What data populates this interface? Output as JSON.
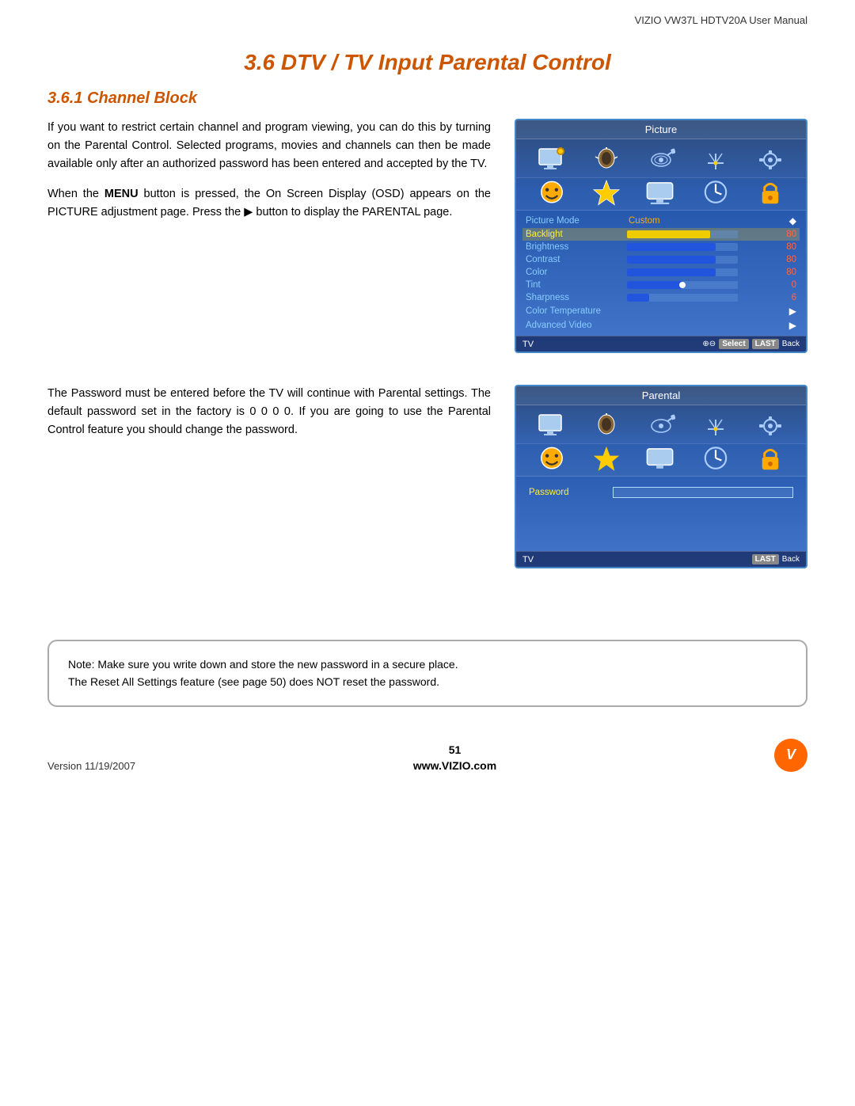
{
  "header": {
    "title": "VIZIO VW37L HDTV20A User Manual"
  },
  "main_title": "3.6 DTV / TV Input Parental Control",
  "section1": {
    "title": "3.6.1 Channel Block",
    "paragraph1": "If you want to restrict certain channel and program viewing, you can do this by turning on the Parental Control.  Selected programs, movies and channels can then be made available only after an authorized password has been entered and accepted by the TV.",
    "paragraph2": "When the MENU button is pressed, the On Screen Display (OSD) appears on the PICTURE adjustment page.  Press the  button to display the PARENTAL page."
  },
  "section2": {
    "paragraph1": "The Password must be entered before the TV will continue with Parental settings.   The default password set in the factory is 0 0 0 0.  If you are going to use the Parental Control feature you should change the password."
  },
  "osd1": {
    "title": "Picture",
    "menu_mode_label": "Picture Mode",
    "menu_mode_value": "Custom",
    "rows": [
      {
        "label": "Backlight",
        "type": "bar-yellow",
        "fill": 0.75,
        "value": "80",
        "highlight": true
      },
      {
        "label": "Brightness",
        "type": "bar",
        "fill": 0.8,
        "value": "80"
      },
      {
        "label": "Contrast",
        "type": "bar",
        "fill": 0.8,
        "value": "80"
      },
      {
        "label": "Color",
        "type": "bar",
        "fill": 0.8,
        "value": "80"
      },
      {
        "label": "Tint",
        "type": "bar-center",
        "fill": 0.5,
        "value": "0"
      },
      {
        "label": "Sharpness",
        "type": "bar",
        "fill": 0.3,
        "value": "6"
      },
      {
        "label": "Color Temperature",
        "type": "arrow"
      },
      {
        "label": "Advanced Video",
        "type": "arrow"
      }
    ],
    "footer_tv": "TV",
    "footer_keys": "⊕⊖ Select  LAST Back"
  },
  "osd2": {
    "title": "Parental",
    "password_label": "Password",
    "footer_tv": "TV",
    "footer_keys": "LAST Back"
  },
  "note": {
    "line1": "Note: Make sure you write down and store the new password in a secure place.",
    "line2": "The Reset All Settings feature (see page 50) does NOT reset the password."
  },
  "footer": {
    "version": "Version 11/19/2007",
    "page_number": "51",
    "website": "www.VIZIO.com",
    "logo_text": "V"
  }
}
